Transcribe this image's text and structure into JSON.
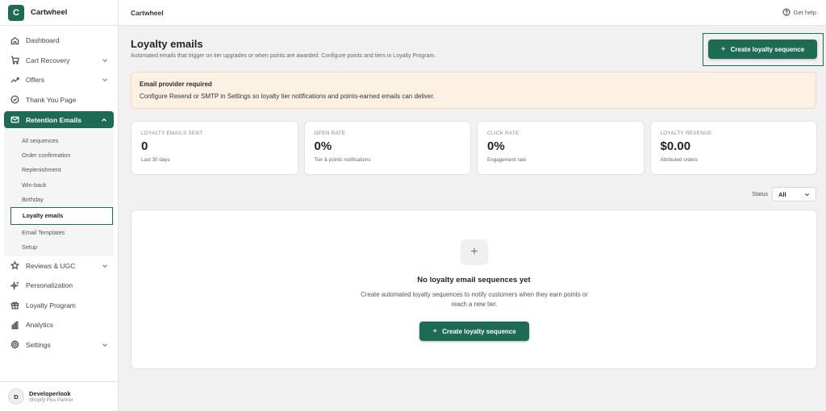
{
  "app": {
    "logo_letter": "C",
    "name": "Cartwheel"
  },
  "topbar": {
    "title": "Cartwheel",
    "help_label": "Get help"
  },
  "sidebar": {
    "items_top": [
      {
        "label": "Dashboard",
        "icon": "home-icon"
      },
      {
        "label": "Cart Recovery",
        "icon": "cart-icon",
        "has_chevron": true
      },
      {
        "label": "Offers",
        "icon": "trend-icon",
        "has_chevron": true
      },
      {
        "label": "Thank You Page",
        "icon": "check-circle-icon"
      }
    ],
    "retention": {
      "label": "Retention Emails",
      "icon": "mail-icon",
      "sub_items": [
        "All sequences",
        "Order confirmation",
        "Replenishment",
        "Win-back",
        "Birthday",
        "Loyalty emails",
        "Email Templates",
        "Setup"
      ],
      "active_index": 5
    },
    "items_bottom": [
      {
        "label": "Reviews & UGC",
        "icon": "star-icon",
        "has_chevron": true
      },
      {
        "label": "Personalization",
        "icon": "sparkle-icon"
      },
      {
        "label": "Loyalty Program",
        "icon": "gift-icon"
      },
      {
        "label": "Analytics",
        "icon": "bar-chart-icon"
      },
      {
        "label": "Settings",
        "icon": "gear-icon",
        "has_chevron": true
      }
    ],
    "profile": {
      "initial": "D",
      "name": "Developerlook",
      "subtitle": "Shopify Plus Partner"
    }
  },
  "main": {
    "title": "Loyalty emails",
    "subtitle": "Automated emails that trigger on tier upgrades or when points are awarded. Configure points and tiers in Loyalty Program.",
    "create_button": "Create loyalty sequence",
    "banner": {
      "title": "Email provider required",
      "body": "Configure Resend or SMTP in Settings so loyalty tier notifications and points-earned emails can deliver."
    },
    "stats": [
      {
        "label": "LOYALTY EMAILS SENT",
        "value": "0",
        "sub": "Last 30 days"
      },
      {
        "label": "OPEN RATE",
        "value": "0%",
        "sub": "Tier & points notifications"
      },
      {
        "label": "CLICK RATE",
        "value": "0%",
        "sub": "Engagement rate"
      },
      {
        "label": "LOYALTY REVENUE",
        "value": "$0.00",
        "sub": "Attributed orders"
      }
    ],
    "status_filter": {
      "label": "Status",
      "value": "All"
    },
    "empty_state": {
      "icon": "+",
      "title": "No loyalty email sequences yet",
      "description": "Create automated loyalty sequences to notify customers when they earn points or reach a new tier.",
      "button": "Create loyalty sequence"
    }
  },
  "colors": {
    "accent": "#1e6b54",
    "banner_bg": "#fdf1e3",
    "page_bg": "#f1f1f1"
  }
}
